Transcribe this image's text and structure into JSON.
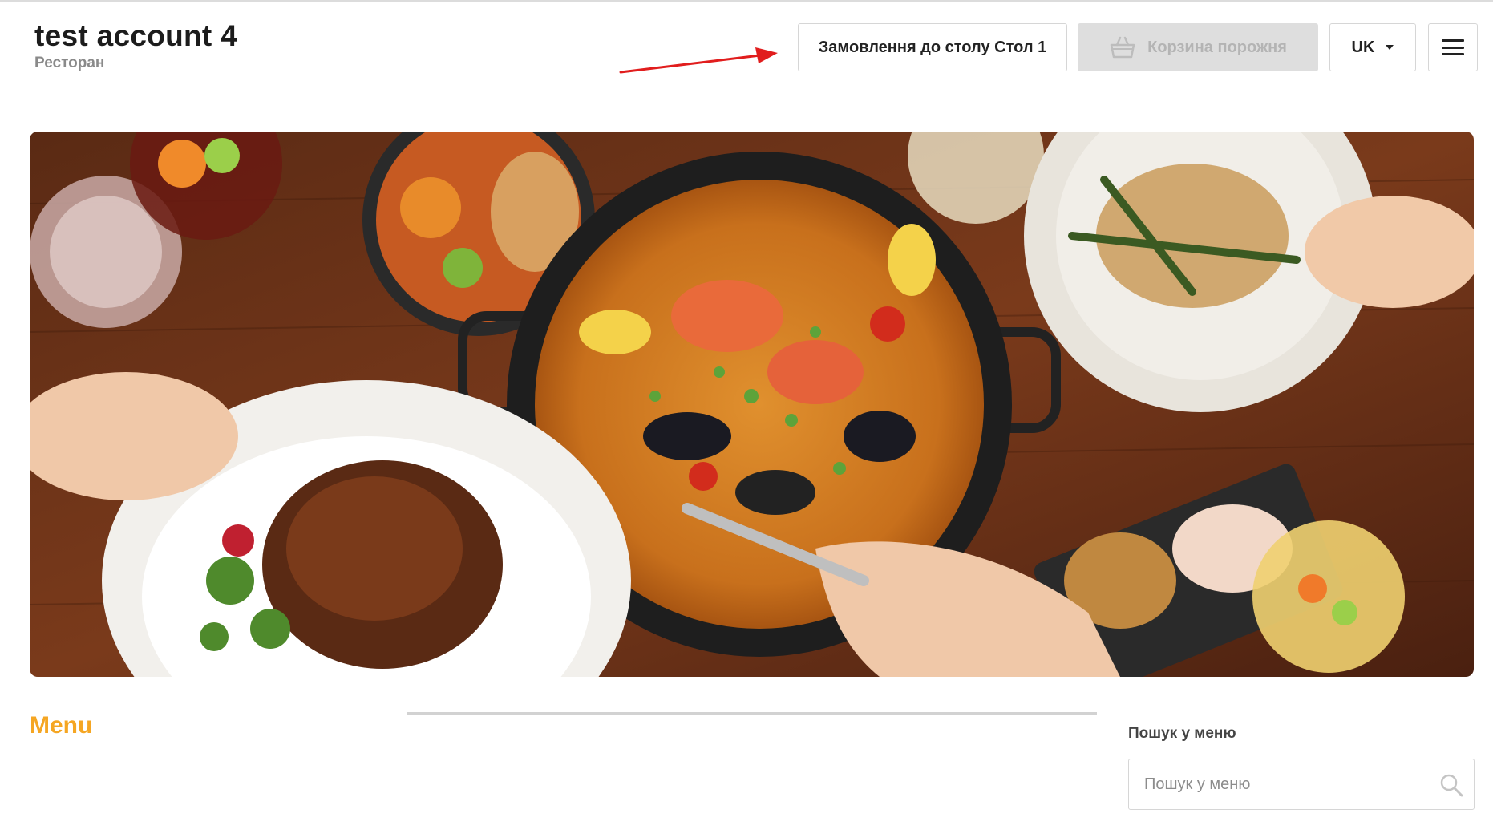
{
  "header": {
    "title": "test account 4",
    "subtitle": "Ресторан",
    "table_order_label": "Замовлення до столу Стол 1",
    "cart_label": "Корзина порожня",
    "language": "UK"
  },
  "hero": {
    "image": "food-table-photo"
  },
  "main": {
    "menu_heading": "Menu",
    "search_label": "Пошук у меню",
    "search_placeholder": "Пошук у меню"
  },
  "colors": {
    "accent": "#f5a623",
    "annotation_arrow": "#e11d1d",
    "cart_disabled_bg": "#dedede"
  },
  "icons": [
    "basket-icon",
    "chevron-down-icon",
    "hamburger-icon",
    "search-icon",
    "red-arrow-annotation"
  ]
}
